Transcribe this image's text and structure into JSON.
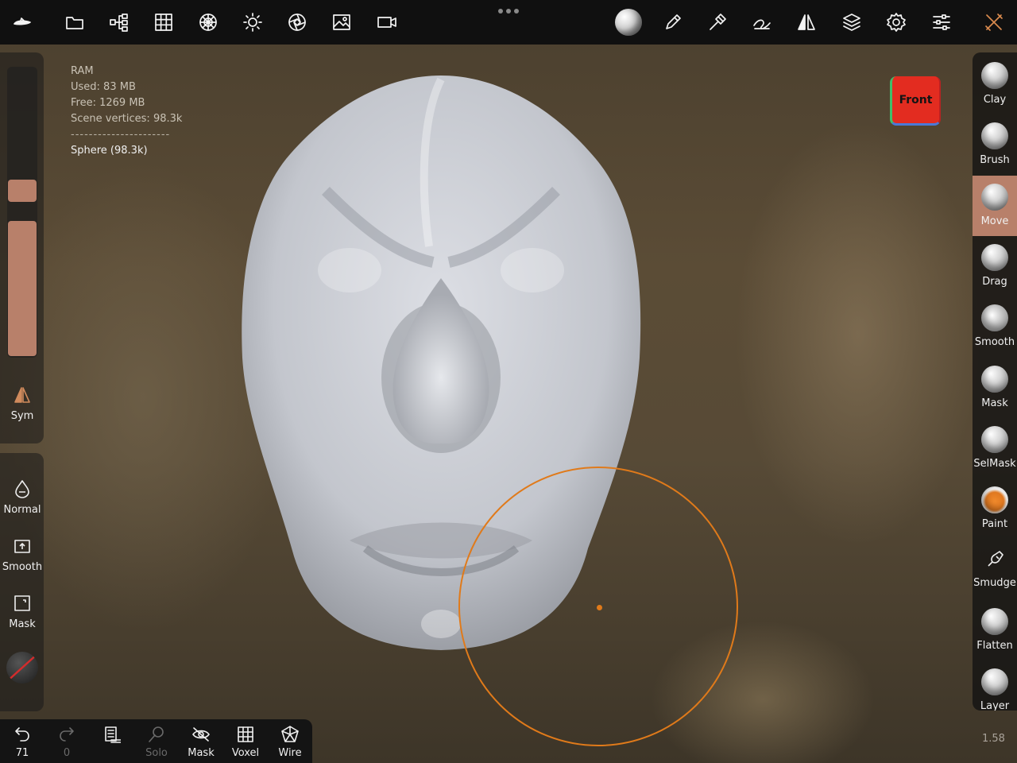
{
  "stats": {
    "ram_label": "RAM",
    "used": "Used: 83 MB",
    "free": "Free: 1269 MB",
    "vertices": "Scene vertices: 98.3k",
    "separator": "----------------------",
    "object": "Sphere (98.3k)"
  },
  "topbar": {
    "icons": [
      "logo-icon",
      "folder-icon",
      "scene-tree-icon",
      "grid-icon",
      "topology-icon",
      "light-icon",
      "camera-aperture-icon",
      "background-image-icon",
      "video-icon",
      "material-sphere-icon",
      "brush-pencil-icon",
      "tool-hammer-icon",
      "stroke-icon",
      "symmetry-icon",
      "layers-icon",
      "settings-gear-icon",
      "sliders-icon",
      "tools-wrench-icon"
    ]
  },
  "view_cube": {
    "label": "Front",
    "color": "#e32c20"
  },
  "left_panel": {
    "sym_label": "Sym",
    "normal_label": "Normal",
    "smooth_label": "Smooth",
    "mask_label": "Mask"
  },
  "brushes": [
    {
      "label": "Clay",
      "active": false
    },
    {
      "label": "Brush",
      "active": false
    },
    {
      "label": "Move",
      "active": true
    },
    {
      "label": "Drag",
      "active": false
    },
    {
      "label": "Smooth",
      "active": false
    },
    {
      "label": "Mask",
      "active": false
    },
    {
      "label": "SelMask",
      "active": false
    },
    {
      "label": "Paint",
      "active": false
    },
    {
      "label": "Smudge",
      "active": false
    },
    {
      "label": "Flatten",
      "active": false
    },
    {
      "label": "Layer",
      "active": false
    }
  ],
  "bottom_bar": {
    "undo_count": "71",
    "redo_count": "0",
    "solo_label": "Solo",
    "mask_label": "Mask",
    "voxel_label": "Voxel",
    "wire_label": "Wire"
  },
  "version": "1.58",
  "colors": {
    "accent": "#b8806a",
    "brush_ring": "#e07a1a",
    "topbar": "#101010"
  }
}
